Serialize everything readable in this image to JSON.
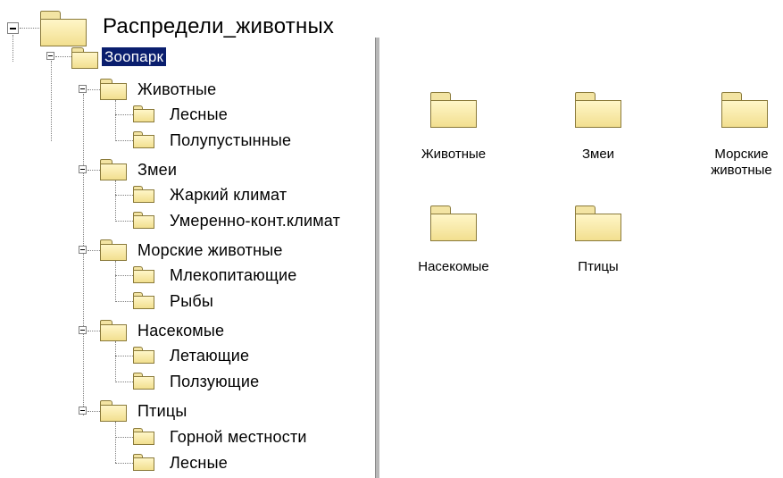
{
  "tree": {
    "root": {
      "label": "Распредели_животных",
      "icon": "folder-icon"
    },
    "zoo": {
      "label": "Зоопарк",
      "icon": "open-folder-icon",
      "selected": true
    },
    "groups": [
      {
        "label": "Животные",
        "children": [
          "Лесные",
          "Полупустынные"
        ]
      },
      {
        "label": "Змеи",
        "children": [
          "Жаркий климат",
          "Умеренно-конт.климат"
        ]
      },
      {
        "label": "Морские животные",
        "children": [
          "Млекопитающие",
          "Рыбы"
        ]
      },
      {
        "label": "Насекомые",
        "children": [
          "Летающие",
          "Ползующие"
        ]
      },
      {
        "label": "Птицы",
        "children": [
          "Горной местности",
          "Лесные"
        ]
      }
    ]
  },
  "content": {
    "items": [
      {
        "label": "Животные"
      },
      {
        "label": "Змеи"
      },
      {
        "label": "Морские животные"
      },
      {
        "label": "Насекомые"
      },
      {
        "label": "Птицы"
      }
    ]
  },
  "colors": {
    "selection": "#0a1e6e",
    "folder": "#f2df8f",
    "splitter": "#b8b8b8"
  }
}
